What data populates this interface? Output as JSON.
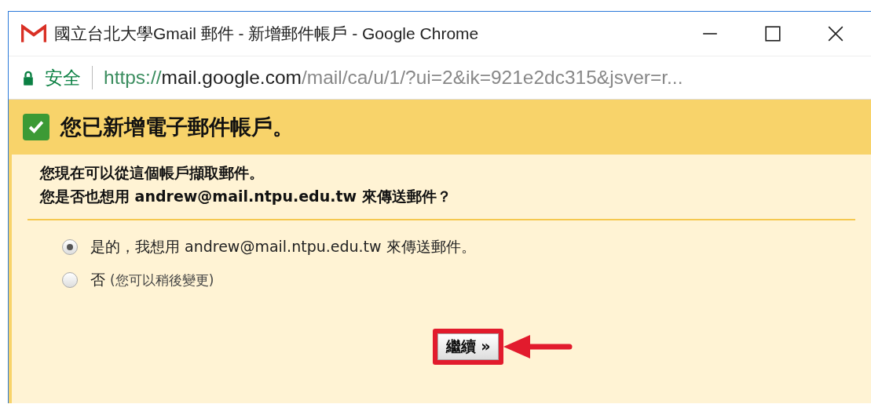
{
  "window": {
    "title": "國立台北大學Gmail 郵件 - 新增郵件帳戶 - Google Chrome"
  },
  "address_bar": {
    "security_label": "安全",
    "url_parts": [
      {
        "text": "https://",
        "kind": "scheme"
      },
      {
        "text": "mail.google.com",
        "kind": "host"
      },
      {
        "text": "/mail/ca/u/1/?ui=2&ik=921e2dc315&jsver=r...",
        "kind": "path"
      }
    ]
  },
  "header": {
    "checked": true,
    "title": "您已新增電子郵件帳戶。"
  },
  "message": [
    "您現在可以從這個帳戶擷取郵件。",
    "您是否也想用 andrew@mail.ntpu.edu.tw 來傳送郵件？"
  ],
  "options": [
    {
      "label": "是的，我想用 andrew@mail.ntpu.edu.tw 來傳送郵件。",
      "selected": true
    },
    {
      "label": "否",
      "note": "(您可以稍後變更)",
      "selected": false
    }
  ],
  "continue_button": {
    "label": "繼續 »"
  }
}
